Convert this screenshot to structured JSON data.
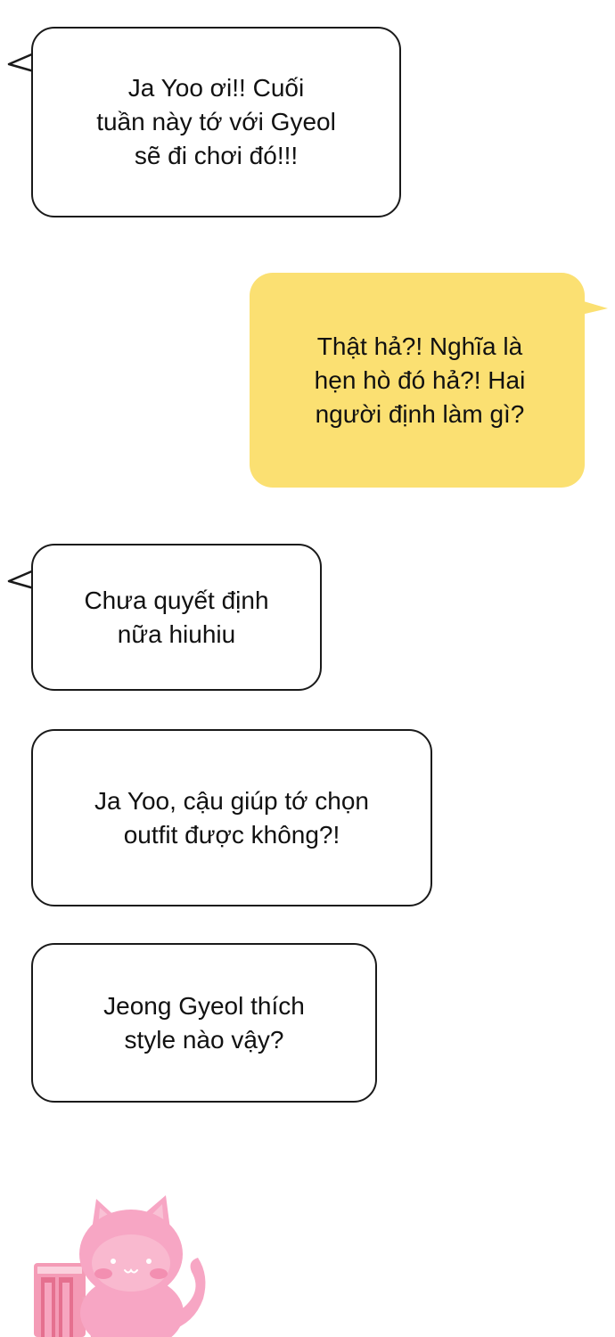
{
  "conversation": {
    "messages": [
      {
        "sender": "friend",
        "text": "Ja Yoo ơi!! Cuối\ntuần này tớ với Gyeol\nsẽ đi chơi đó!!!"
      },
      {
        "sender": "me",
        "text": "Thật hả?! Nghĩa là\nhẹn hò đó hả?! Hai\nngười định làm gì?"
      },
      {
        "sender": "friend",
        "text": "Chưa quyết định\nnữa hiuhiu"
      },
      {
        "sender": "friend",
        "text": "Ja Yoo, cậu giúp tớ chọn\noutfit được không?!"
      },
      {
        "sender": "friend",
        "text": "Jeong Gyeol thích\nstyle nào vậy?"
      }
    ]
  },
  "colors": {
    "friend_bubble": "#ffffff",
    "friend_border": "#1a1a1a",
    "me_bubble": "#fbe072",
    "cat": "#f7a6c4"
  },
  "icons": {
    "sticker": "pink-cat-sticker-icon"
  }
}
